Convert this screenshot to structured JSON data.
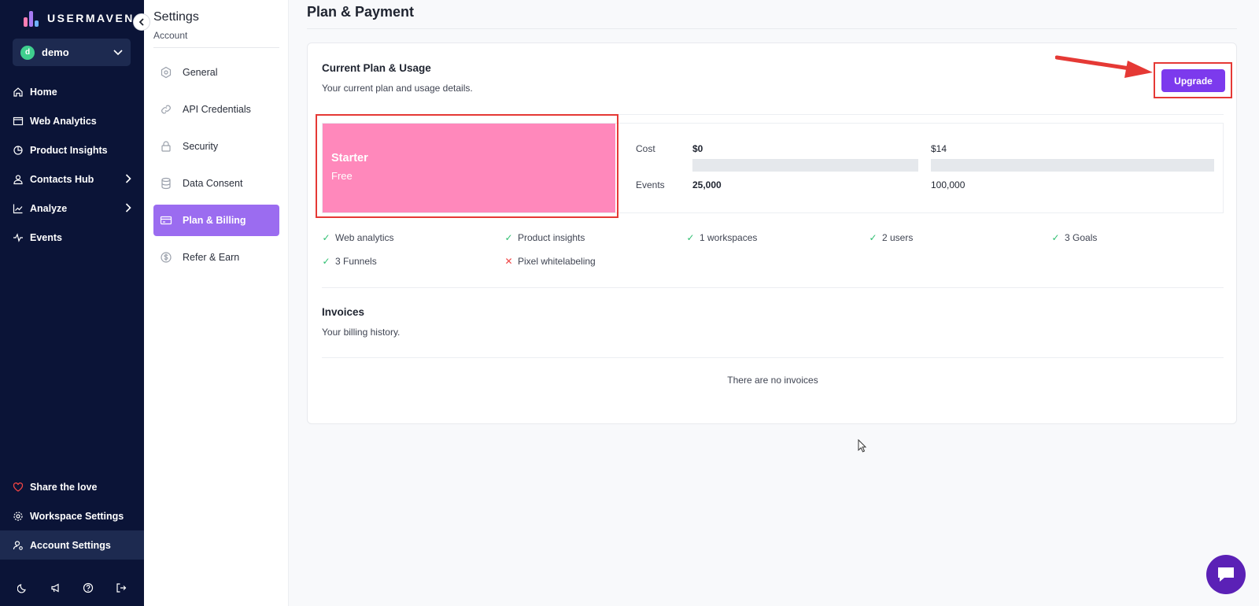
{
  "brand": {
    "name": "USERMAVEN."
  },
  "workspace": {
    "initial": "d",
    "name": "demo"
  },
  "sidebar": {
    "items": [
      {
        "label": "Home"
      },
      {
        "label": "Web Analytics"
      },
      {
        "label": "Product Insights"
      },
      {
        "label": "Contacts Hub"
      },
      {
        "label": "Analyze"
      },
      {
        "label": "Events"
      }
    ],
    "bottom_items": [
      {
        "label": "Share the love"
      },
      {
        "label": "Workspace Settings"
      },
      {
        "label": "Account Settings"
      }
    ]
  },
  "settings_nav": {
    "title": "Settings",
    "subtitle": "Account",
    "items": [
      {
        "label": "General"
      },
      {
        "label": "API Credentials"
      },
      {
        "label": "Security"
      },
      {
        "label": "Data Consent"
      },
      {
        "label": "Plan & Billing"
      },
      {
        "label": "Refer & Earn"
      }
    ]
  },
  "page": {
    "title": "Plan & Payment"
  },
  "plan_card": {
    "heading": "Current Plan & Usage",
    "description": "Your current plan and usage details.",
    "upgrade_label": "Upgrade",
    "plan_name": "Starter",
    "plan_price": "Free",
    "usage": {
      "cost_label": "Cost",
      "events_label": "Events",
      "current_cost": "$0",
      "next_cost": "$14",
      "current_events": "25,000",
      "next_events": "100,000"
    },
    "features": [
      {
        "label": "Web analytics",
        "included": true
      },
      {
        "label": "Product insights",
        "included": true
      },
      {
        "label": "1 workspaces",
        "included": true
      },
      {
        "label": "2 users",
        "included": true
      },
      {
        "label": "3 Goals",
        "included": true
      },
      {
        "label": "3 Funnels",
        "included": true
      },
      {
        "label": "Pixel whitelabeling",
        "included": false
      }
    ]
  },
  "invoices": {
    "heading": "Invoices",
    "description": "Your billing history.",
    "empty_text": "There are no invoices"
  },
  "colors": {
    "sidebar_bg": "#0b1437",
    "accent": "#7c3aed",
    "active_nav": "#9b6cf0",
    "plan_tile": "#ff88bb",
    "highlight": "#e53935"
  }
}
